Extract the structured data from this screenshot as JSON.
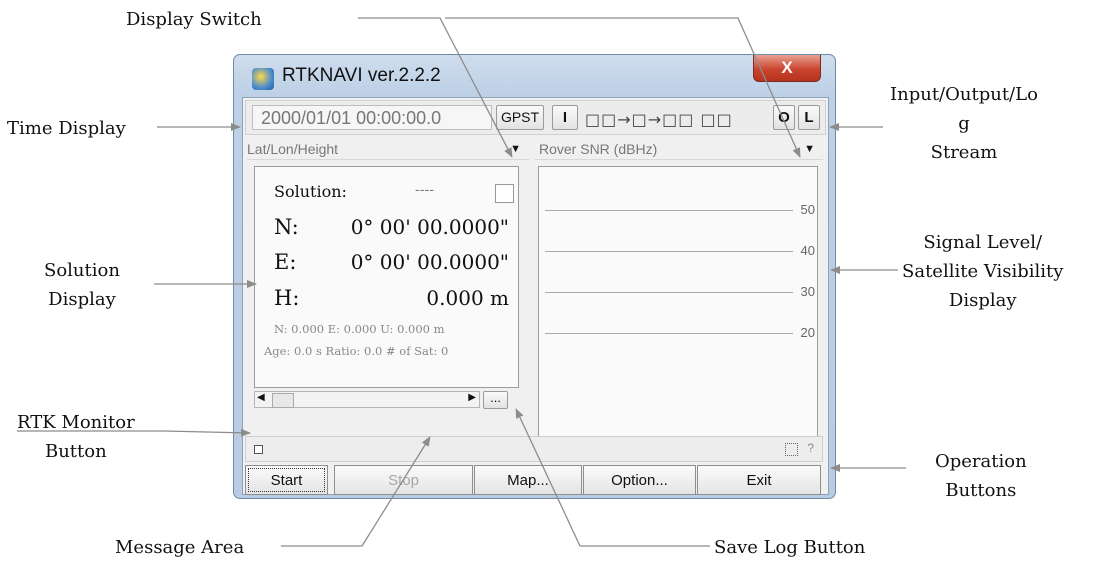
{
  "window": {
    "title": "RTKNAVI ver.2.2.2",
    "close_label": "X"
  },
  "toolbar": {
    "time": "2000/01/01 00:00:00.0",
    "time_sys_label": "GPST",
    "input_label": "I",
    "stream_indicator": "□□→□→□□ □□",
    "output_label": "O",
    "log_label": "L"
  },
  "solution": {
    "mode_label": "Lat/Lon/Height",
    "status_label": "Solution:",
    "status_value": "----",
    "n_label": "N:",
    "n_value": "0° 00' 00.0000\"",
    "e_label": "E:",
    "e_value": "0° 00' 00.0000\"",
    "h_label": "H:",
    "h_value": "0.000 m",
    "std_line": "N: 0.000 E: 0.000 U: 0.000 m",
    "age_line": "Age: 0.0 s Ratio: 0.0 # of Sat: 0",
    "more_label": "..."
  },
  "signal": {
    "mode_label": "Rover SNR (dBHz)",
    "levels": [
      "50",
      "40",
      "30",
      "20"
    ]
  },
  "message": {
    "help_label": "?"
  },
  "buttons": {
    "start": "Start",
    "stop": "Stop",
    "map": "Map...",
    "option": "Option...",
    "exit": "Exit"
  },
  "callouts": {
    "display_switch": "Display Switch",
    "time_display": "Time Display",
    "io_log_1": "Input/Output/Lo",
    "io_log_2": "g",
    "io_log_3": "Stream",
    "solution_display_1": "Solution",
    "solution_display_2": "Display",
    "signal_1": "Signal Level/",
    "signal_2": "Satellite Visibility",
    "signal_3": "Display",
    "rtk_monitor_1": "RTK Monitor",
    "rtk_monitor_2": "Button",
    "operation_1": "Operation",
    "operation_2": "Buttons",
    "message_area": "Message Area",
    "save_log": "Save Log Button"
  }
}
